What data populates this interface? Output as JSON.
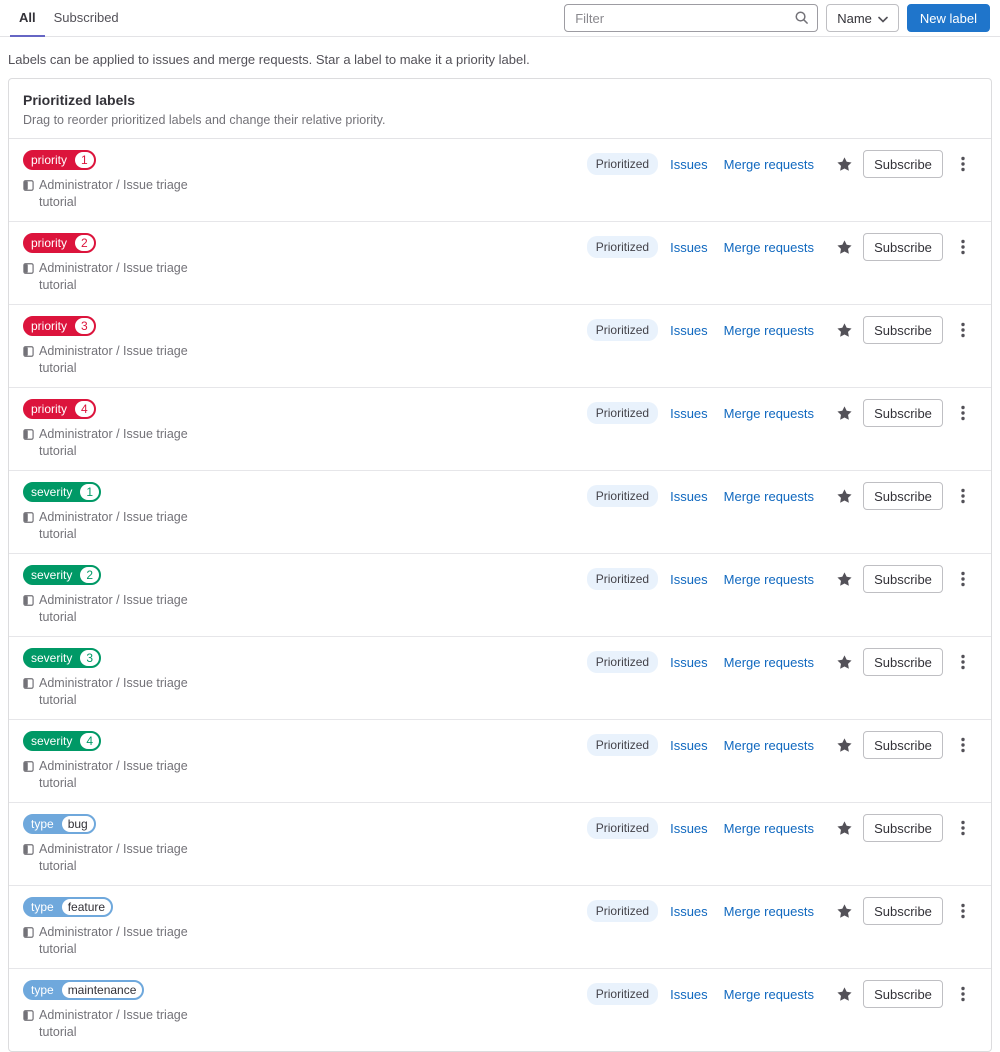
{
  "tabs": {
    "all": "All",
    "subscribed": "Subscribed"
  },
  "toolbar": {
    "filter_placeholder": "Filter",
    "sort_label": "Name",
    "new_label": "New label"
  },
  "description": "Labels can be applied to issues and merge requests. Star a label to make it a priority label.",
  "panel": {
    "title": "Prioritized labels",
    "subtitle": "Drag to reorder prioritized labels and change their relative priority."
  },
  "actions": {
    "prioritized": "Prioritized",
    "issues": "Issues",
    "merge_requests": "Merge requests",
    "subscribe": "Subscribe"
  },
  "icons": {
    "search": "search-icon",
    "sort_chevron": "chevron-down-icon",
    "project": "project-icon",
    "star": "star-icon",
    "row_menu": "kebab-menu-icon"
  },
  "colors": {
    "label_red": "#dc143c",
    "label_green": "#009966",
    "label_blue": "#6fa8dc",
    "link": "#1068bf",
    "primary_button": "#1f75cb",
    "tab_indicator": "#6666c4",
    "prioritized_badge_bg": "#e9f2fc"
  },
  "labels": [
    {
      "scope": "priority",
      "value": "1",
      "color": "#dc143c",
      "value_color": "#dc143c",
      "project": "Administrator / Issue triage tutorial"
    },
    {
      "scope": "priority",
      "value": "2",
      "color": "#dc143c",
      "value_color": "#dc143c",
      "project": "Administrator / Issue triage tutorial"
    },
    {
      "scope": "priority",
      "value": "3",
      "color": "#dc143c",
      "value_color": "#dc143c",
      "project": "Administrator / Issue triage tutorial"
    },
    {
      "scope": "priority",
      "value": "4",
      "color": "#dc143c",
      "value_color": "#dc143c",
      "project": "Administrator / Issue triage tutorial"
    },
    {
      "scope": "severity",
      "value": "1",
      "color": "#009966",
      "value_color": "#009966",
      "project": "Administrator / Issue triage tutorial"
    },
    {
      "scope": "severity",
      "value": "2",
      "color": "#009966",
      "value_color": "#009966",
      "project": "Administrator / Issue triage tutorial"
    },
    {
      "scope": "severity",
      "value": "3",
      "color": "#009966",
      "value_color": "#009966",
      "project": "Administrator / Issue triage tutorial"
    },
    {
      "scope": "severity",
      "value": "4",
      "color": "#009966",
      "value_color": "#009966",
      "project": "Administrator / Issue triage tutorial"
    },
    {
      "scope": "type",
      "value": "bug",
      "color": "#6fa8dc",
      "value_color": "#333238",
      "project": "Administrator / Issue triage tutorial"
    },
    {
      "scope": "type",
      "value": "feature",
      "color": "#6fa8dc",
      "value_color": "#333238",
      "project": "Administrator / Issue triage tutorial"
    },
    {
      "scope": "type",
      "value": "maintenance",
      "color": "#6fa8dc",
      "value_color": "#333238",
      "project": "Administrator / Issue triage tutorial"
    }
  ]
}
